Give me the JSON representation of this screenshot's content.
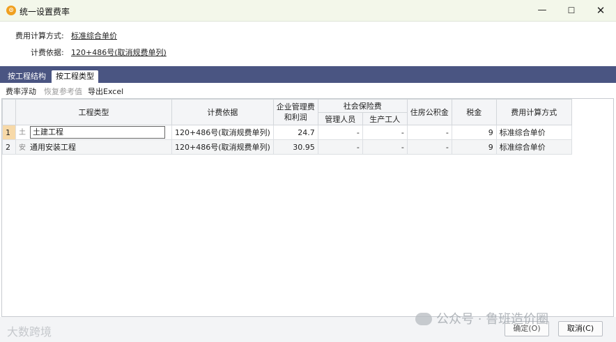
{
  "window": {
    "title": "统一设置费率",
    "app_icon": "app-logo-icon"
  },
  "header": {
    "calc_method_label": "费用计算方式:",
    "calc_method_value": "标准综合单价",
    "basis_label": "计费依据:",
    "basis_value": "120+486号(取消规费单列)"
  },
  "tabs": [
    {
      "label": "按工程结构",
      "active": false
    },
    {
      "label": "按工程类型",
      "active": true
    }
  ],
  "toolbar": {
    "float_label": "费率浮动",
    "restore_label": "恢复参考值",
    "export_label": "导出Excel"
  },
  "table": {
    "headers": {
      "type": "工程类型",
      "basis": "计费依据",
      "mgmt": "企业管理费和利润",
      "social": "社会保险费",
      "social_mgr": "管理人员",
      "social_worker": "生产工人",
      "housing": "住房公积金",
      "tax": "税金",
      "calc": "费用计算方式"
    },
    "rows": [
      {
        "num": "1",
        "icon": "building-icon",
        "type": "土建工程",
        "basis": "120+486号(取消规费单列)",
        "mgmt": "24.7",
        "social_mgr": "-",
        "social_worker": "-",
        "housing": "-",
        "tax": "9",
        "calc": "标准综合单价"
      },
      {
        "num": "2",
        "icon": "install-icon",
        "type": "通用安装工程",
        "basis": "120+486号(取消规费单列)",
        "mgmt": "30.95",
        "social_mgr": "-",
        "social_worker": "-",
        "housing": "-",
        "tax": "9",
        "calc": "标准综合单价"
      }
    ]
  },
  "footer": {
    "ok_label": "确定(O)",
    "cancel_label": "取消(C)"
  },
  "watermarks": {
    "wechat": "公众号 · 鲁班造价圈",
    "corner": "大数跨境"
  }
}
